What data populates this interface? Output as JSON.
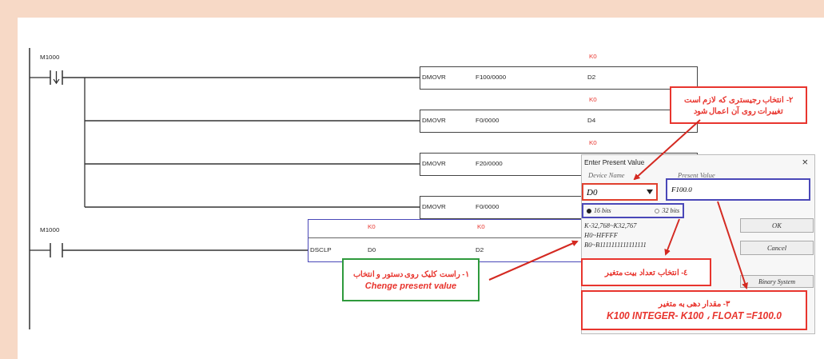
{
  "ladder": {
    "rungs": [
      {
        "contact": {
          "label": "M1000",
          "kind": "falling"
        },
        "instructions": [
          {
            "mnemonic": "DMOVR",
            "operand_1": "F100/0000",
            "operand_2": "D2",
            "monitor_2": "K0",
            "highlighted": false
          },
          {
            "mnemonic": "DMOVR",
            "operand_1": "F0/0000",
            "operand_2": "D4",
            "monitor_2": "K0",
            "highlighted": false
          },
          {
            "mnemonic": "DMOVR",
            "operand_1": "F20/0000",
            "monitor_2": "K0",
            "highlighted": false
          },
          {
            "mnemonic": "DMOVR",
            "operand_1": "F0/0000",
            "highlighted": false
          }
        ]
      },
      {
        "contact": {
          "label": "M1000",
          "kind": "normally_open"
        },
        "instructions": [
          {
            "mnemonic": "DSCLP",
            "operand_1": "D0",
            "operand_2": "D2",
            "monitor_1": "K0",
            "monitor_2": "K0",
            "highlighted": true
          }
        ]
      }
    ]
  },
  "dialog": {
    "title": "Enter Present Value",
    "close": "×",
    "device_name_label": "Device Name",
    "device_name": "D0",
    "present_value_label": "Present Value",
    "present_value": "F100.0",
    "radios": [
      {
        "label": "16 bits",
        "selected": true
      },
      {
        "label": "32 bits",
        "selected": false
      }
    ],
    "ranges": [
      "K-32,768~K32,767",
      "H0~HFFFF",
      "B0~B1111111111111111"
    ],
    "buttons": [
      "OK",
      "Cancel",
      "Binary System"
    ]
  },
  "callouts": [
    {
      "lines": [
        "۲- انتخاب رجیستری که لازم است",
        "تغییرات روی آن اعمال شود"
      ],
      "color": "#e8352e"
    },
    {
      "lines": [
        "٤- انتخاب تعداد بیت متغیر"
      ],
      "color": "#e8352e"
    },
    {
      "lines": [
        "۱- راست کلیک روی دستور و انتخاب",
        "Chenge present value"
      ],
      "color": "#2e9a3c"
    },
    {
      "lines": [
        "۳- مقدار دهی به متغیر",
        "K100 INTEGER- K100 ، FLOAT =F100.0"
      ],
      "color": "#e8352e"
    }
  ]
}
